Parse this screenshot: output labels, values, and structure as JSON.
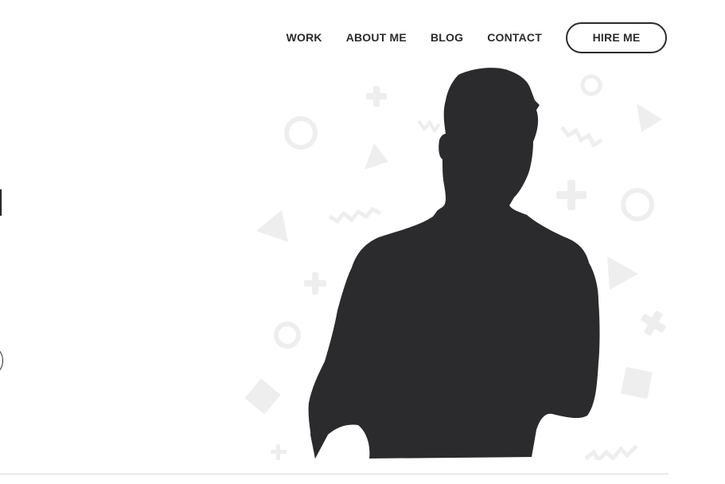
{
  "nav": {
    "items": [
      {
        "label": "WORK"
      },
      {
        "label": "ABOUT ME"
      },
      {
        "label": "BLOG"
      },
      {
        "label": "CONTACT"
      }
    ],
    "hire_label": "HIRE ME"
  },
  "hero": {
    "title_fragment": "I",
    "illustration": "person-silhouette"
  },
  "colors": {
    "text": "#2b2b2d",
    "silhouette": "#2b2b2d",
    "shapes": "#eeeeee",
    "background": "#ffffff"
  }
}
